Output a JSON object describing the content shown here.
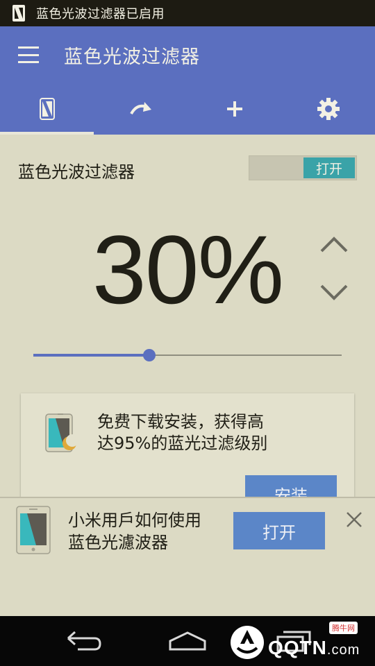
{
  "statusbar": {
    "text": "蓝色光波过滤器已启用",
    "icon": "phone-filter-icon"
  },
  "appbar": {
    "title": "蓝色光波过滤器",
    "menu_icon": "hamburger-menu-icon"
  },
  "tabs": [
    {
      "icon": "phone-filter-icon",
      "active": true
    },
    {
      "icon": "redo-arrow-icon",
      "active": false
    },
    {
      "icon": "plus-icon",
      "active": false
    },
    {
      "icon": "gear-icon",
      "active": false
    }
  ],
  "filter": {
    "label": "蓝色光波过滤器",
    "toggle_label": "打开",
    "enabled": true
  },
  "intensity": {
    "text": "30%",
    "value": 30,
    "slider_fraction": 0.375
  },
  "promo": {
    "line1": "免费下载安装，获得高",
    "line2": "达95%的蓝光过滤级别",
    "button_label": "安装"
  },
  "banner": {
    "line1": "小米用戶如何使用",
    "line2": "蓝色光濾波器",
    "button_label": "打开"
  },
  "watermark": {
    "text": "QQTN",
    "suffix": ".com",
    "badge": "腾牛网"
  },
  "colors": {
    "primary": "#5b6fbf",
    "accent": "#3aa3a8",
    "button": "#5b86c8",
    "background": "#dcdac4",
    "text": "#201f16"
  }
}
